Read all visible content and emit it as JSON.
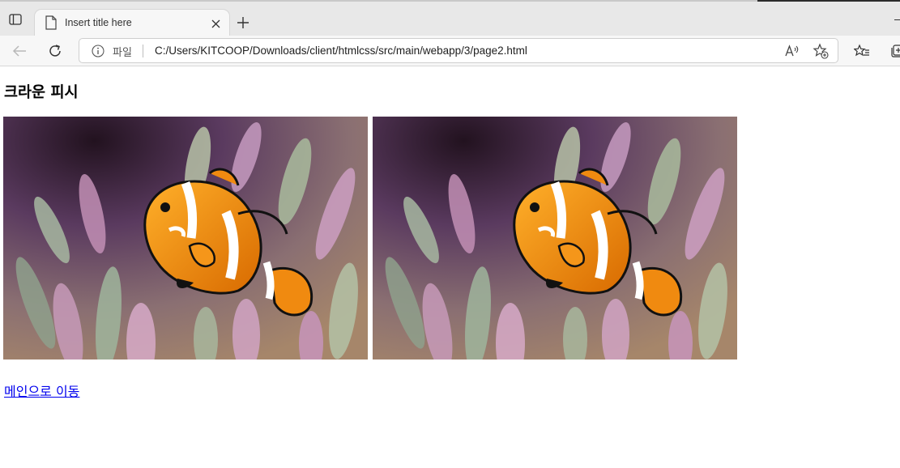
{
  "browser": {
    "tab": {
      "title": "Insert title here"
    },
    "address_bar": {
      "scheme_label": "파일",
      "url": "C:/Users/KITCOOP/Downloads/client/htmlcss/src/main/webapp/3/page2.html"
    },
    "icons": {
      "tab_actions": "tab-actions-icon",
      "page": "page-icon",
      "close": "close-icon",
      "new_tab": "plus-icon",
      "back": "back-arrow-icon",
      "refresh": "refresh-icon",
      "info": "info-icon",
      "read_aloud": "read-aloud-icon",
      "add_favorite": "star-plus-icon",
      "favorites": "favorites-icon",
      "collections": "collections-icon"
    }
  },
  "page": {
    "heading": "크라운 피시",
    "images": [
      {
        "subject": "clownfish",
        "count_shown": 2
      }
    ],
    "link": {
      "label": "메인으로 이동"
    }
  },
  "colors": {
    "link": "#0000ee",
    "clownfish_orange": "#f08a10",
    "anemone_pink": "#c98bb8"
  }
}
